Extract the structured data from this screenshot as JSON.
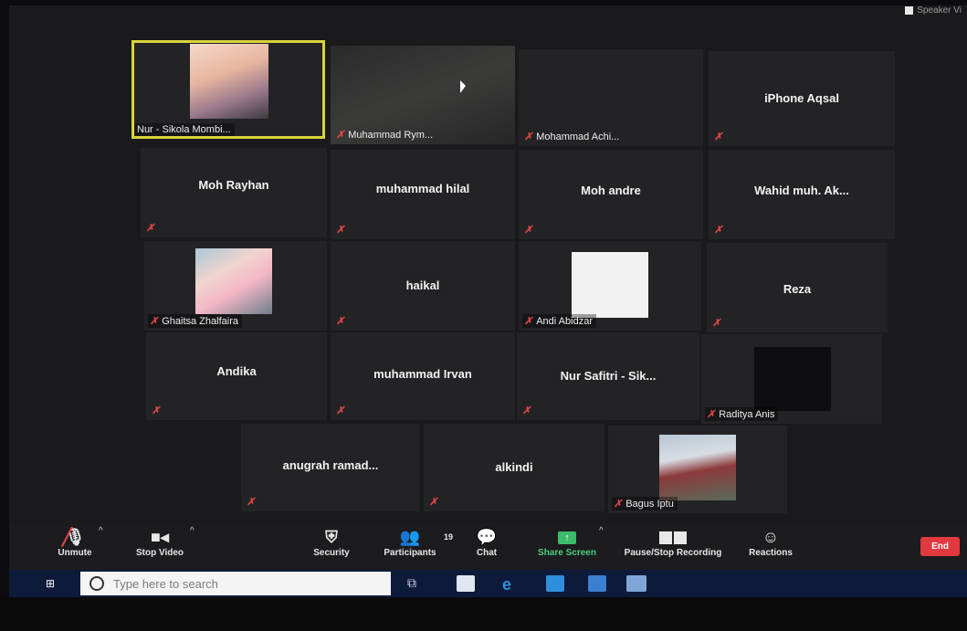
{
  "corner_view_label": "Speaker Vi",
  "tiles": {
    "t1": {
      "name": "Nur - Sikola Mombi..."
    },
    "t2": {
      "name": "Muhammad Rym..."
    },
    "t3": {
      "name": "Mohammad Achi..."
    },
    "t4": {
      "name": "iPhone Aqsal"
    },
    "t5": {
      "name": "Moh Rayhan"
    },
    "t6": {
      "name": "muhammad hilal"
    },
    "t7": {
      "name": "Moh andre"
    },
    "t8": {
      "name": "Wahid muh. Ak..."
    },
    "t9": {
      "name": "Ghaitsa Zhalfaira"
    },
    "t10": {
      "name": "haikal"
    },
    "t11": {
      "name": "Andi Abidzar"
    },
    "t12": {
      "name": "Reza"
    },
    "t13": {
      "name": "Andika"
    },
    "t14": {
      "name": "muhammad Irvan"
    },
    "t15": {
      "name": "Nur Safitri - Sik..."
    },
    "t16": {
      "name": "Raditya Anis"
    },
    "t17": {
      "name": "anugrah ramad..."
    },
    "t18": {
      "name": "alkindi"
    },
    "t19": {
      "name": "Bagus Iptu"
    }
  },
  "toolbar": {
    "unmute": "Unmute",
    "stop_video": "Stop Video",
    "security": "Security",
    "participants": "Participants",
    "participant_count": "19",
    "chat": "Chat",
    "share_screen": "Share Screen",
    "recording": "Pause/Stop Recording",
    "reactions": "Reactions",
    "end": "End"
  },
  "taskbar": {
    "search_placeholder": "Type here to search"
  },
  "colors": {
    "active_speaker": "#d8d43c",
    "muted": "#e04545",
    "share_green": "#4ccf7a",
    "end_red": "#e0393e"
  }
}
